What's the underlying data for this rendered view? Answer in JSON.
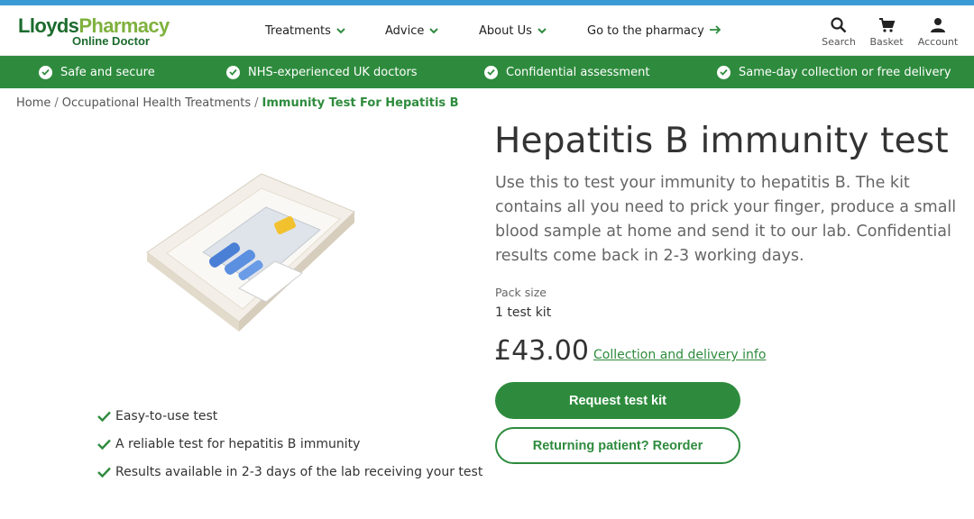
{
  "colors": {
    "brand_green": "#2e8b3d",
    "logo_dark_green": "#1c6b2e",
    "logo_light_green": "#7fb13e",
    "top_accent_blue": "#3a9bd4"
  },
  "logo": {
    "part1": "Lloyds",
    "part2": "Pharmacy",
    "sub": "Online Doctor"
  },
  "nav": {
    "treatments": "Treatments",
    "advice": "Advice",
    "about": "About Us",
    "pharmacy": "Go to the pharmacy",
    "search": "Search",
    "basket": "Basket",
    "account": "Account"
  },
  "trust_bar": [
    "Safe and secure",
    "NHS-experienced UK doctors",
    "Confidential assessment",
    "Same-day collection or free delivery"
  ],
  "breadcrumb": {
    "home": "Home",
    "category": "Occupational Health Treatments",
    "current": "Immunity Test For Hepatitis B"
  },
  "product": {
    "title": "Hepatitis B immunity test",
    "description": "Use this to test your immunity to hepatitis B. The kit contains all you need to prick your finger, produce a small blood sample at home and send it to our lab. Confidential results come back in 2-3 working days.",
    "pack_size_label": "Pack size",
    "pack_size_value": "1 test kit",
    "price": "£43.00",
    "delivery_link": "Collection and delivery info",
    "request_button": "Request test kit",
    "reorder_button": "Returning patient? Reorder",
    "benefits": [
      "Easy-to-use test",
      "A reliable test for hepatitis B immunity",
      "Results available in 2-3 days of the lab receiving your test"
    ]
  }
}
